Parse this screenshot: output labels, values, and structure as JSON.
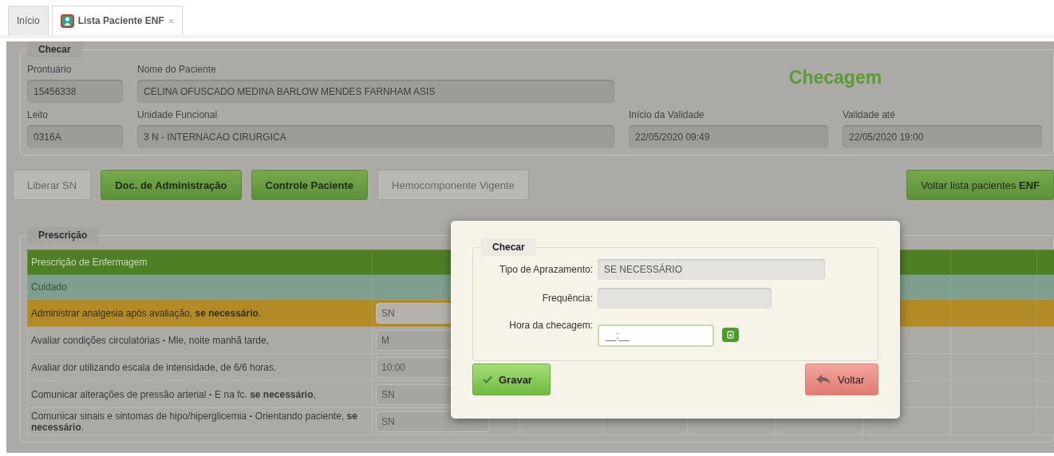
{
  "tabs": [
    {
      "label": "Início",
      "selected": false
    },
    {
      "label": "Lista Paciente ENF",
      "selected": true,
      "close": "×"
    }
  ],
  "patient": {
    "legend": "Checar",
    "title": "Checagem",
    "fields": [
      {
        "label": "Prontuário",
        "value": "15456338"
      },
      {
        "label": "Nome do Paciente",
        "value": "CELINA OFUSCADO MEDINA BARLOW MENDES FARNHAM ASIS"
      },
      {
        "label": "Leito",
        "value": "0316A"
      },
      {
        "label": "Unidade Funcional",
        "value": "3 N - INTERNACAO CIRURGICA"
      },
      {
        "label": "Início da Validade",
        "value": "22/05/2020 09:49"
      },
      {
        "label": "Validade até",
        "value": "22/05/2020 19:00"
      }
    ]
  },
  "actions": [
    {
      "label": "Liberar SN",
      "disabled": true
    },
    {
      "label": "Doc. de Administração",
      "disabled": false
    },
    {
      "label": "Controle Paciente",
      "disabled": false
    },
    {
      "label": "Hemocomponente Vigente",
      "disabled": true
    }
  ],
  "back_button": {
    "label": "Voltar lista pacientes **ENF**"
  },
  "prescription": {
    "legend": "Prescrição",
    "header": "Prescrição de Enfermagem",
    "group": "Cuidado",
    "rows": [
      {
        "text": "Administrar analgesia após avaliação, **se necessário**.",
        "schedule": "SN",
        "highlighted": true
      },
      {
        "text": "Avaliar condições circulatórias **-** Mle, noite manhã tarde,",
        "schedule": "M",
        "highlighted": false
      },
      {
        "text": "Avaliar dor utilizando escala de intensidade, de 6/6 horas.",
        "schedule": "10:00",
        "highlighted": false
      },
      {
        "text": "Comunicar alterações de pressão arterial **-** E na fc. **se necessário**,",
        "schedule": "SN",
        "highlighted": false
      },
      {
        "text": "Comunicar sinais e sintomas de hipo/hiperglicemia **-** Orientando paciente, **se necessário**.",
        "schedule": "SN",
        "highlighted": false
      }
    ]
  },
  "dialog": {
    "legend": "Checar",
    "fields": [
      {
        "label": "Tipo de Aprazamento:",
        "value": "SE NECESSÁRIO",
        "kind": "readonly"
      },
      {
        "label": "Frequência:",
        "kind": "readonly"
      },
      {
        "label": "Hora da checagem:",
        "value": "__:__",
        "kind": "time"
      }
    ],
    "save": "Gravar",
    "back": "Voltar"
  }
}
